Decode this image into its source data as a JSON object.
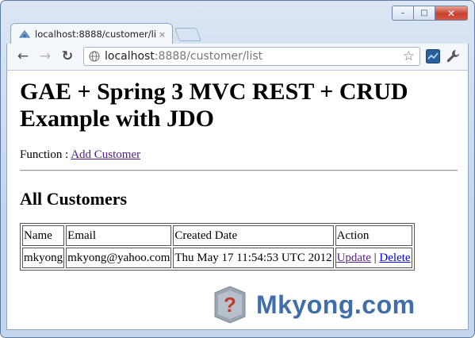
{
  "browser": {
    "tab_title": "localhost:8888/customer/lis",
    "tab_close": "×",
    "address": {
      "host": "localhost",
      "rest": ":8888/customer/list"
    },
    "buttons": {
      "back": "←",
      "forward": "→",
      "reload": "↻",
      "bookmark_star": "☆"
    },
    "window_controls": {
      "minimize": "–",
      "maximize": "□",
      "close": "✕"
    }
  },
  "page": {
    "heading": "GAE + Spring 3 MVC REST + CRUD Example with JDO",
    "function_label": "Function : ",
    "add_customer_link": "Add Customer",
    "section_title": "All Customers",
    "table": {
      "headers": [
        "Name",
        "Email",
        "Created Date",
        "Action"
      ],
      "rows": [
        {
          "name": "mkyong",
          "email": "mkyong@yahoo.com",
          "created": "Thu May 17 11:54:53 UTC 2012",
          "update": "Update",
          "separator": " | ",
          "delete": "Delete"
        }
      ]
    }
  },
  "watermark": {
    "text": "Mkyong.com",
    "icon_glyph": "?"
  },
  "colors": {
    "visited_link": "#551a8b",
    "link": "#0000ee",
    "watermark": "#3f6ea8",
    "close_button": "#c9402f"
  }
}
